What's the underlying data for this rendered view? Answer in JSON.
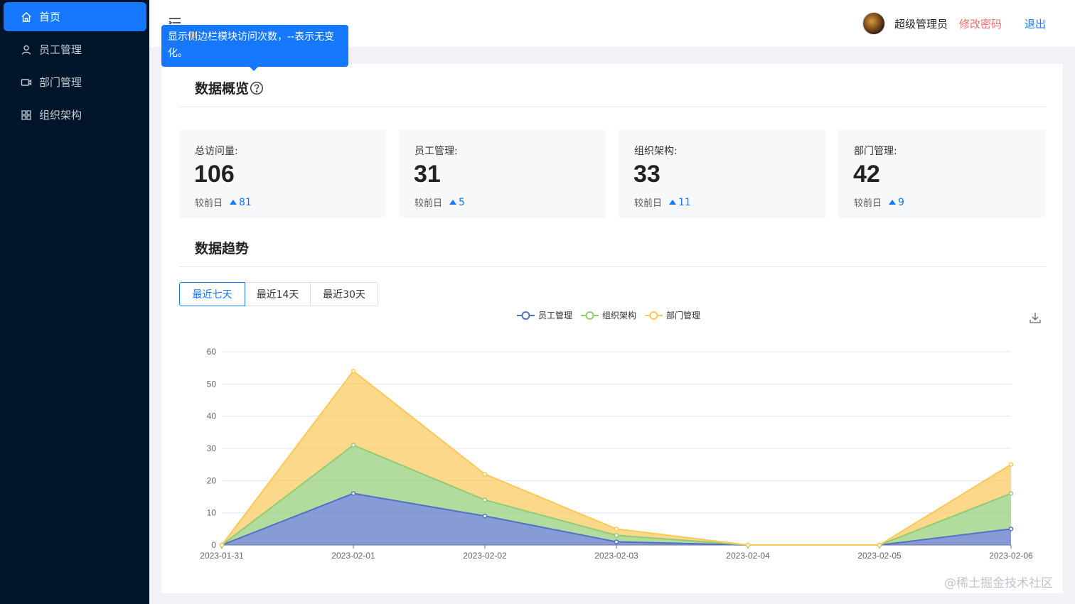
{
  "sidebar": {
    "items": [
      {
        "label": "首页",
        "icon": "home-icon",
        "active": true
      },
      {
        "label": "员工管理",
        "icon": "user-icon",
        "active": false
      },
      {
        "label": "部门管理",
        "icon": "video-icon",
        "active": false
      },
      {
        "label": "组织架构",
        "icon": "grid-icon",
        "active": false
      }
    ]
  },
  "header": {
    "username": "超级管理员",
    "change_password": "修改密码",
    "logout": "退出"
  },
  "tooltip": {
    "text": "显示侧边栏模块访问次数，--表示无变化。"
  },
  "overview": {
    "title": "数据概览",
    "compare_label": "较前日",
    "cards": [
      {
        "label": "总访问量:",
        "value": "106",
        "delta": "81"
      },
      {
        "label": "员工管理:",
        "value": "31",
        "delta": "5"
      },
      {
        "label": "组织架构:",
        "value": "33",
        "delta": "11"
      },
      {
        "label": "部门管理:",
        "value": "42",
        "delta": "9"
      }
    ]
  },
  "trend": {
    "title": "数据趋势",
    "ranges": [
      "最近七天",
      "最近14天",
      "最近30天"
    ],
    "active_range": 0
  },
  "chart_data": {
    "type": "area",
    "stacked": true,
    "x": [
      "2023-01-31",
      "2023-02-01",
      "2023-02-02",
      "2023-02-03",
      "2023-02-04",
      "2023-02-05",
      "2023-02-06"
    ],
    "series": [
      {
        "name": "员工管理",
        "values": [
          0,
          16,
          9,
          1,
          0,
          0,
          5
        ],
        "color": "#5470c6"
      },
      {
        "name": "组织架构",
        "values": [
          0,
          15,
          5,
          2,
          0,
          0,
          11
        ],
        "color": "#91cc75"
      },
      {
        "name": "部门管理",
        "values": [
          0,
          23,
          8,
          2,
          0,
          0,
          9
        ],
        "color": "#fac858"
      }
    ],
    "yticks": [
      0,
      10,
      20,
      30,
      40,
      50,
      60
    ],
    "ylim": [
      0,
      60
    ],
    "legend": "top-center",
    "grid": true
  },
  "watermark": "@稀土掘金技术社区"
}
